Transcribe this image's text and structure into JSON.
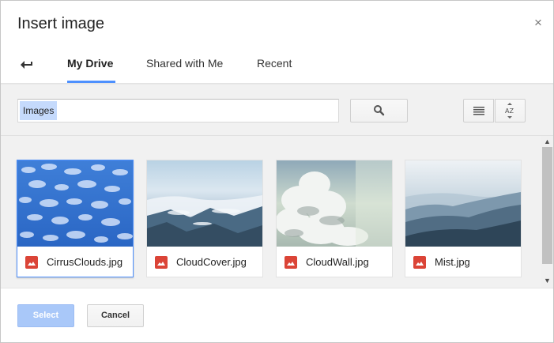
{
  "dialog": {
    "title": "Insert image",
    "close_glyph": "×"
  },
  "tabs": [
    {
      "label": "My Drive",
      "active": true
    },
    {
      "label": "Shared with Me",
      "active": false
    },
    {
      "label": "Recent",
      "active": false
    }
  ],
  "search": {
    "token": "Images",
    "placeholder": ""
  },
  "files": [
    {
      "name": "CirrusClouds.jpg",
      "selected": true
    },
    {
      "name": "CloudCover.jpg",
      "selected": false
    },
    {
      "name": "CloudWall.jpg",
      "selected": false
    },
    {
      "name": "Mist.jpg",
      "selected": false
    }
  ],
  "footer": {
    "select_label": "Select",
    "cancel_label": "Cancel"
  },
  "colors": {
    "accent": "#4d90fe",
    "file_icon": "#db4437",
    "select_disabled": "#a9c8f9"
  },
  "icons": {
    "back": "back-arrow-icon",
    "search": "search-icon",
    "list_view": "list-view-icon",
    "sort": "sort-az-icon",
    "file": "image-file-icon",
    "close": "close-icon"
  }
}
